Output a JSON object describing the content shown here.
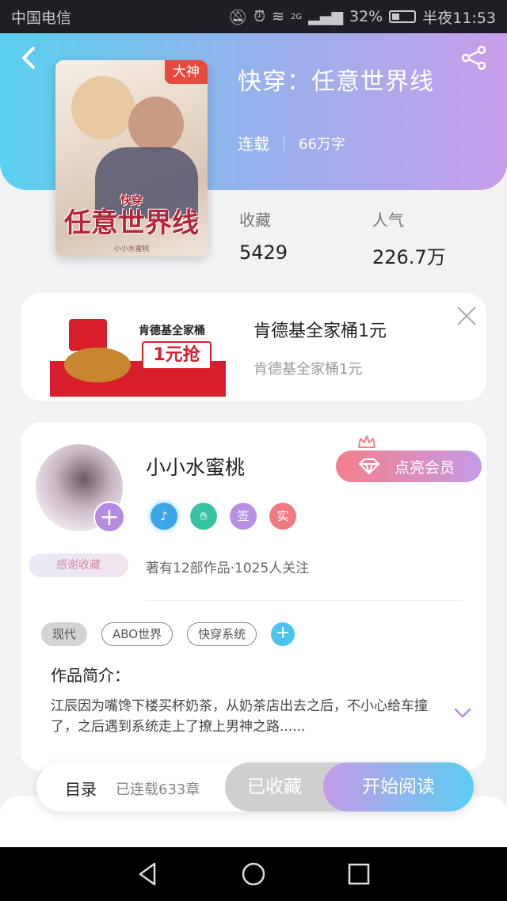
{
  "status_bar": {
    "carrier": "中国电信",
    "network": "2G",
    "battery": "32%",
    "time": "半夜11:53"
  },
  "book": {
    "title": "快穿：任意世界线",
    "status": "连载",
    "word_count": "66万字",
    "cover_badge": "大神",
    "cover_title": "任意世界线",
    "cover_prefix": "快穿",
    "cover_author": "小小水蜜桃",
    "stats": [
      {
        "label": "收藏",
        "value": "5429"
      },
      {
        "label": "人气",
        "value": "226.7万"
      }
    ]
  },
  "ad": {
    "title": "肯德基全家桶1元",
    "subtitle": "肯德基全家桶1元",
    "image_text_1": "肯德基全家桶",
    "image_text_2": "1元抢"
  },
  "author": {
    "name": "小小水蜜桃",
    "thanks_label": "感谢收藏",
    "vip_button": "点亮会员",
    "badges": [
      "",
      "",
      "签",
      "实"
    ],
    "info": "著有12部作品·1025人关注"
  },
  "tags": [
    "现代",
    "ABO世界",
    "快穿系统"
  ],
  "intro": {
    "label": "作品简介：",
    "text": "江辰因为嘴馋下楼买杯奶茶，从奶茶店出去之后，不小心给车撞了，之后遇到系统走上了撩上男神之路......"
  },
  "bottom_bar": {
    "catalog": "目录",
    "chapters": "已连载633章",
    "collected": "已收藏",
    "read": "开始阅读"
  },
  "colors": {
    "header_start": "#58d0ef",
    "header_end": "#c79ee9",
    "accent_red": "#e8493f",
    "vip_pink": "#f47f8c"
  },
  "icons": {
    "back": "back-arrow-icon",
    "share": "share-icon",
    "close": "close-icon",
    "expand": "chevron-down-icon"
  }
}
